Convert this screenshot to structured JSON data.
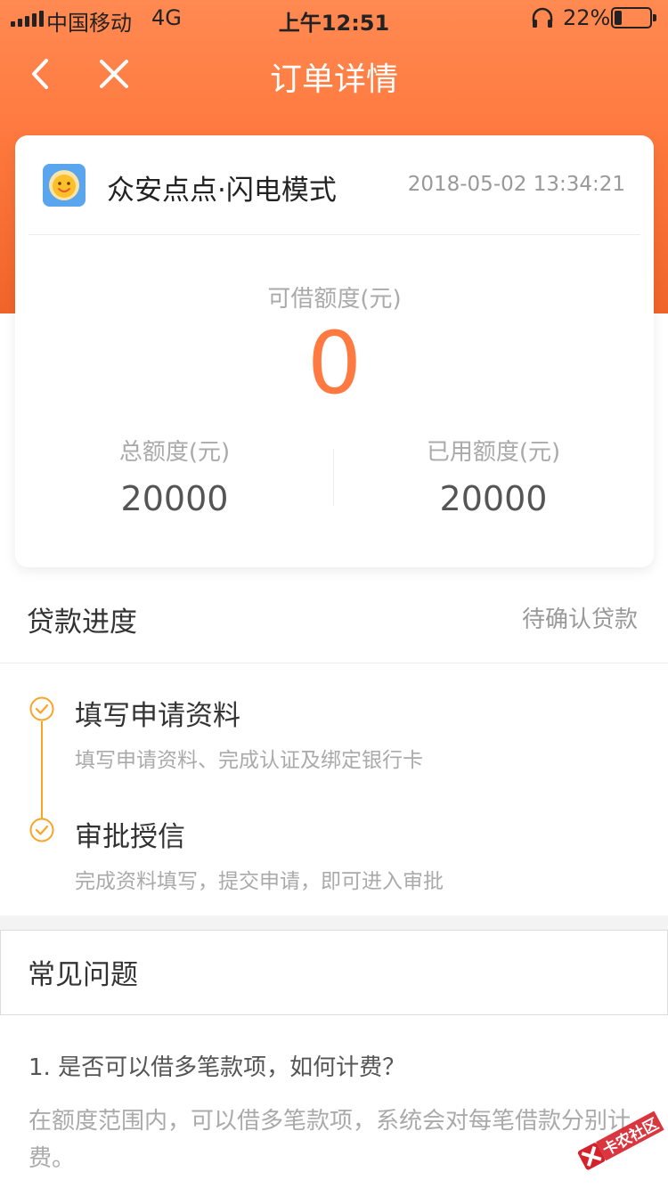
{
  "status_bar": {
    "carrier": "中国移动",
    "network": "4G",
    "time": "上午12:51",
    "battery_percent": "22%",
    "battery_level": 0.22
  },
  "nav": {
    "title": "订单详情",
    "back_icon": "chevron-left-icon",
    "close_icon": "close-icon"
  },
  "card": {
    "product_name": "众安点点·闪电模式",
    "timestamp": "2018-05-02 13:34:21",
    "available_label": "可借额度(元)",
    "available_value": "0",
    "total_label": "总额度(元)",
    "total_value": "20000",
    "used_label": "已用额度(元)",
    "used_value": "20000"
  },
  "progress": {
    "title": "贷款进度",
    "status": "待确认贷款",
    "steps": [
      {
        "title": "填写申请资料",
        "desc": "填写申请资料、完成认证及绑定银行卡"
      },
      {
        "title": "审批授信",
        "desc": "完成资料填写，提交申请，即可进入审批"
      }
    ]
  },
  "faq": {
    "title": "常见问题",
    "items": [
      {
        "q": "1. 是否可以借多笔款项，如何计费？",
        "a": "在额度范围内，可以借多笔款项，系统会对每笔借款分别计费。"
      }
    ]
  },
  "watermark": {
    "text": "卡农社区"
  },
  "colors": {
    "header_orange": "#ff7a40",
    "accent_orange": "#ff7a40",
    "step_yellow": "#f7a427"
  }
}
